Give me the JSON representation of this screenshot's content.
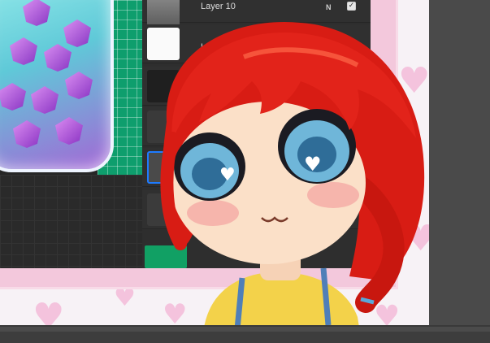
{
  "layers_panel": {
    "layers": [
      {
        "label": "Layer 10",
        "mode": "N",
        "visible": true
      },
      {
        "label": "Lay",
        "mode": "",
        "visible": true
      }
    ],
    "selected_layer_index": 4
  },
  "icons": {
    "visibility_check": "check-icon",
    "blend_mode": "N",
    "overlay_decoration": "heart-icon"
  },
  "colors": {
    "selection_accent": "#1e7bff",
    "canvas_grid": "#0e9e6d",
    "overlay_pink": "#f3c8dc",
    "hair_red": "#e2231a",
    "eye_blue": "#6fb6d9"
  },
  "visibility_mark": "✓"
}
